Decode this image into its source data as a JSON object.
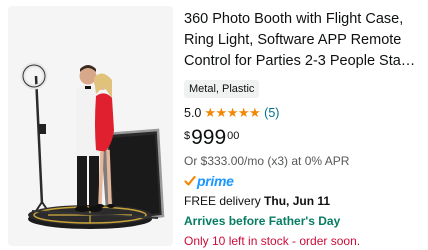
{
  "product": {
    "title": "360 Photo Booth with Flight Case, Ring Light, Software APP Remote Control for Parties 2-3 People Sta…",
    "material_badge": "Metal, Plastic",
    "rating": {
      "value": "5.0",
      "stars_out_of_5": 5,
      "review_count": "(5)"
    },
    "price": {
      "symbol": "$",
      "whole": "999",
      "fraction": "00"
    },
    "installment": "Or $333.00/mo (x3) at 0% APR",
    "prime_label": "prime",
    "delivery": {
      "prefix": "FREE delivery ",
      "date": "Thu, Jun 11"
    },
    "promo": "Arrives before Father's Day",
    "stock": "Only 10 left in stock - order soon."
  },
  "colors": {
    "star": "#f08804",
    "link": "#007185",
    "prime_blue": "#1a98ff",
    "promo_green": "#067d62",
    "stock_red": "#cc0c39",
    "badge_bg": "#f0f2f2",
    "image_bg": "#f5f5f5"
  },
  "icons": {
    "star": "star-icon",
    "prime_check": "prime-check-icon"
  }
}
